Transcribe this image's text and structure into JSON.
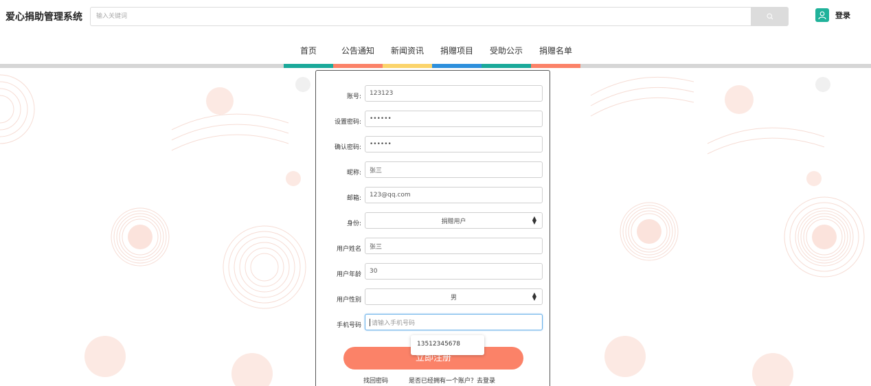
{
  "header": {
    "brand": "爱心捐助管理系统",
    "search_placeholder": "输入关键词",
    "login_label": "登录"
  },
  "nav": {
    "items": [
      {
        "label": "首页",
        "color": "#1aa99a"
      },
      {
        "label": "公告通知",
        "color": "#fb8268"
      },
      {
        "label": "新闻资讯",
        "color": "#fbd46b"
      },
      {
        "label": "捐赠项目",
        "color": "#2d8fdc"
      },
      {
        "label": "受助公示",
        "color": "#1aa99a"
      },
      {
        "label": "捐赠名单",
        "color": "#fb8268"
      }
    ]
  },
  "form": {
    "account": {
      "label": "账号:",
      "value": "123123"
    },
    "password": {
      "label": "设置密码:",
      "value": "••••••"
    },
    "confirm_password": {
      "label": "确认密码:",
      "value": "••••••"
    },
    "nickname": {
      "label": "昵称:",
      "value": "张三"
    },
    "email": {
      "label": "邮箱:",
      "value": "123@qq.com"
    },
    "identity": {
      "label": "身份:",
      "value": "捐赠用户"
    },
    "real_name": {
      "label": "用户姓名",
      "value": "张三"
    },
    "age": {
      "label": "用户年龄",
      "value": "30"
    },
    "gender": {
      "label": "用户性别",
      "value": "男"
    },
    "phone": {
      "label": "手机号码",
      "placeholder": "请输入手机号码",
      "suggestion": "13512345678"
    },
    "submit_label": "立即注册",
    "forgot_label": "找回密码",
    "have_account_label": "是否已经拥有一个账户？去登录"
  },
  "colors": {
    "accent_coral": "#fb8268",
    "accent_teal": "#1aa99a"
  }
}
